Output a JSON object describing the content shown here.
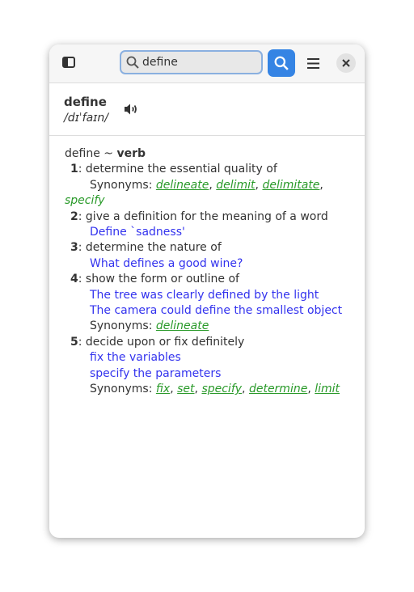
{
  "header": {
    "search_value": "define"
  },
  "word": {
    "title": "define",
    "pronunciation": "/dɪˈfaɪn/"
  },
  "entry": {
    "headword": "define",
    "separator": " ~ ",
    "pos": "verb"
  },
  "synonyms_label": "Synonyms: ",
  "senses": [
    {
      "num": "1",
      "definition": "determine the essential quality of",
      "examples": [],
      "synonyms": [
        "delineate",
        "delimit",
        "delimitate",
        "specify"
      ]
    },
    {
      "num": "2",
      "definition": "give a definition for the meaning of a word",
      "examples": [
        "Define `sadness'"
      ],
      "synonyms": []
    },
    {
      "num": "3",
      "definition": "determine the nature of",
      "examples": [
        "What defines a good wine?"
      ],
      "synonyms": []
    },
    {
      "num": "4",
      "definition": "show the form or outline of",
      "examples": [
        "The tree was clearly defined by the light",
        "The camera could define the smallest object"
      ],
      "synonyms": [
        "delineate"
      ]
    },
    {
      "num": "5",
      "definition": "decide upon or fix definitely",
      "examples": [
        "fix the variables",
        "specify the parameters"
      ],
      "synonyms": [
        "fix",
        "set",
        "specify",
        "determine",
        "limit"
      ]
    }
  ],
  "colors": {
    "accent": "#3584e4",
    "example": "#3333ee",
    "synonym": "#2a9a2a"
  }
}
